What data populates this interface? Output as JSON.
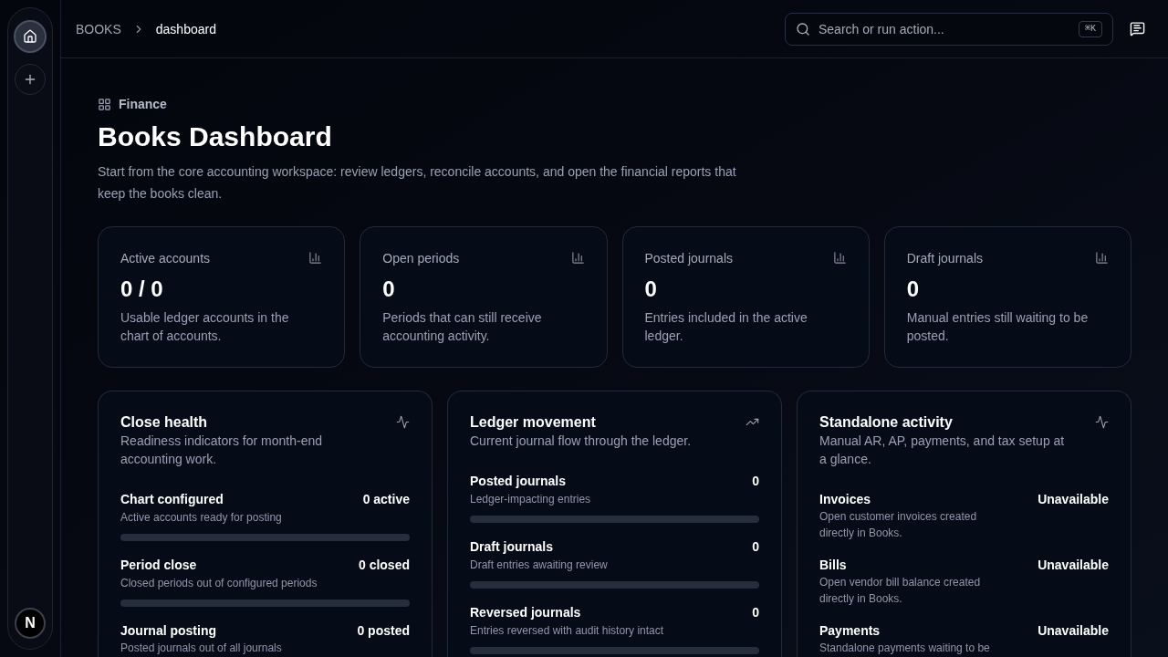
{
  "sidebar": {
    "items": [
      {
        "kind": "home",
        "selected": true
      },
      {
        "kind": "add",
        "selected": false
      }
    ],
    "avatar": "N"
  },
  "breadcrumb": [
    {
      "label": "BOOKS",
      "current": false
    },
    {
      "label": "dashboard",
      "current": true
    }
  ],
  "search": {
    "placeholder": "Search or run action...",
    "shortcut": "⌘K"
  },
  "header": {
    "eyebrow": "Finance",
    "title": "Books Dashboard",
    "description": "Start from the core accounting workspace: review ledgers, reconcile accounts, and open the financial reports that keep the books clean."
  },
  "stats": [
    {
      "label": "Active accounts",
      "value": "0 / 0",
      "description": "Usable ledger accounts in the chart of accounts."
    },
    {
      "label": "Open periods",
      "value": "0",
      "description": "Periods that can still receive accounting activity."
    },
    {
      "label": "Posted journals",
      "value": "0",
      "description": "Entries included in the active ledger."
    },
    {
      "label": "Draft journals",
      "value": "0",
      "description": "Manual entries still waiting to be posted."
    }
  ],
  "panels": [
    {
      "title": "Close health",
      "description": "Readiness indicators for month-end accounting work.",
      "rows": [
        {
          "kind": "meter",
          "name": "Chart configured",
          "description": "Active accounts ready for posting",
          "value": "0 active"
        },
        {
          "kind": "meter",
          "name": "Period close",
          "description": "Closed periods out of configured periods",
          "value": "0 closed"
        },
        {
          "kind": "text",
          "name": "Journal posting",
          "description": "Posted journals out of all journals",
          "value": "0 posted"
        }
      ]
    },
    {
      "title": "Ledger movement",
      "description": "Current journal flow through the ledger.",
      "rows": [
        {
          "kind": "meter",
          "name": "Posted journals",
          "description": "Ledger-impacting entries",
          "value": "0"
        },
        {
          "kind": "meter",
          "name": "Draft journals",
          "description": "Draft entries awaiting review",
          "value": "0"
        },
        {
          "kind": "meter",
          "name": "Reversed journals",
          "description": "Entries reversed with audit history intact",
          "value": "0"
        }
      ]
    },
    {
      "title": "Standalone activity",
      "description": "Manual AR, AP, payments, and tax setup at a glance.",
      "rows": [
        {
          "kind": "text",
          "name": "Invoices",
          "description": "Open customer invoices created directly in Books.",
          "value": "Unavailable"
        },
        {
          "kind": "text",
          "name": "Bills",
          "description": "Open vendor bill balance created directly in Books.",
          "value": "Unavailable"
        },
        {
          "kind": "text",
          "name": "Payments",
          "description": "Standalone payments waiting to be",
          "value": "Unavailable"
        }
      ]
    }
  ]
}
